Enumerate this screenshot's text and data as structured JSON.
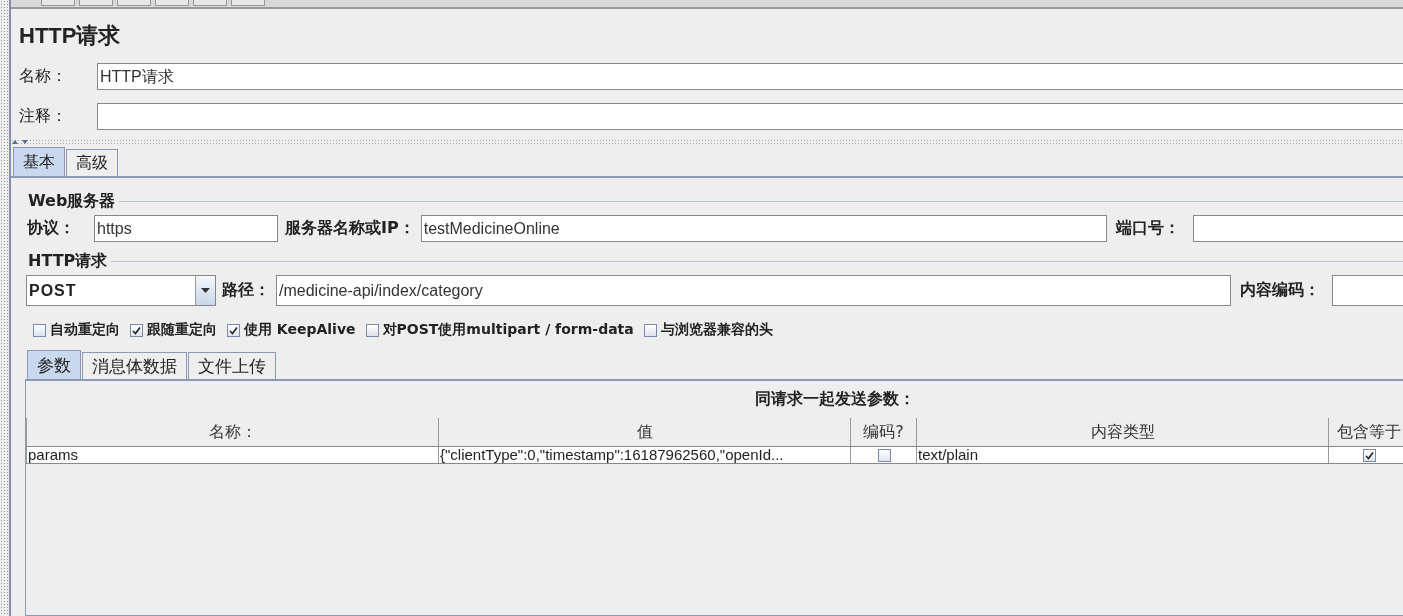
{
  "title": "HTTP请求",
  "name_field": {
    "label": "名称：",
    "value": "HTTP请求"
  },
  "comment_field": {
    "label": "注释："
  },
  "tabs": [
    {
      "label": "基本",
      "selected": true
    },
    {
      "label": "高级",
      "selected": false
    }
  ],
  "web_server": {
    "legend": "Web服务器",
    "protocol": {
      "label": "协议：",
      "value": "https"
    },
    "server": {
      "label": "服务器名称或IP：",
      "value": "testMedicineOnline"
    },
    "port": {
      "label": "端口号："
    }
  },
  "http_request": {
    "legend": "HTTP请求",
    "method": "POST",
    "path": {
      "label": "路径：",
      "value": "/medicine-api/index/category"
    },
    "encoding": {
      "label": "内容编码："
    },
    "options": [
      {
        "label": "自动重定向",
        "checked": false
      },
      {
        "label": "跟随重定向",
        "checked": true
      },
      {
        "label": "使用 KeepAlive",
        "checked": true
      },
      {
        "label": "对POST使用multipart / form-data",
        "checked": false
      },
      {
        "label": "与浏览器兼容的头",
        "checked": false
      }
    ]
  },
  "sub_tabs": [
    {
      "label": "参数",
      "selected": true
    },
    {
      "label": "消息体数据",
      "selected": false
    },
    {
      "label": "文件上传",
      "selected": false
    }
  ],
  "params_table": {
    "title": "同请求一起发送参数：",
    "columns": [
      "名称：",
      "值",
      "编码?",
      "内容类型",
      "包含等于"
    ],
    "rows": [
      {
        "name": "params",
        "value": "{\"clientType\":0,\"timestamp\":16187962560,\"openId...",
        "encode": false,
        "content_type": "text/plain",
        "include_equals": true
      }
    ]
  }
}
